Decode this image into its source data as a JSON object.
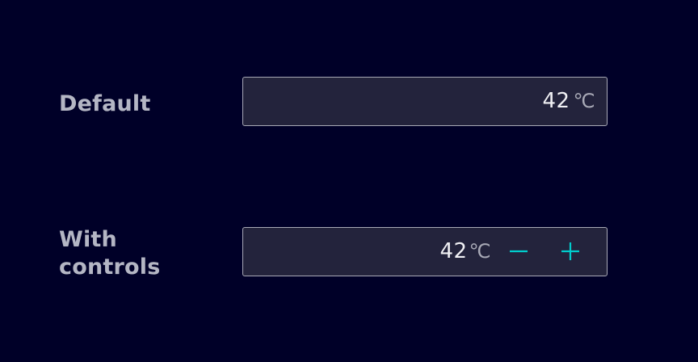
{
  "rows": [
    {
      "label": "Default",
      "value": "42",
      "unit": "℃"
    },
    {
      "label": "With controls",
      "value": "42",
      "unit": "℃"
    }
  ],
  "controls": {
    "decrement_icon": "minus-icon",
    "increment_icon": "plus-icon",
    "icon_color": "#00cccc"
  },
  "colors": {
    "background": "#000028",
    "field_background": "#23233c",
    "field_border": "#a8a9b6",
    "label": "#b4b6c4",
    "value": "#f0f0f4"
  }
}
